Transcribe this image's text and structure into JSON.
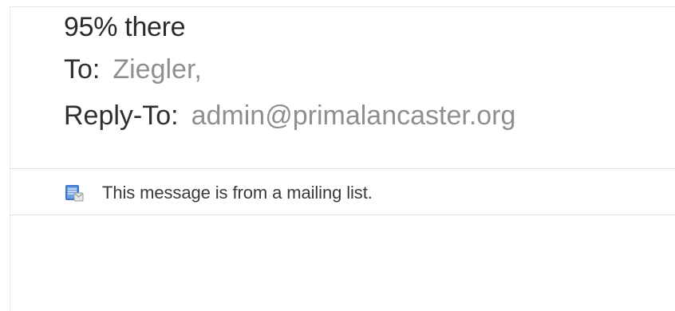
{
  "header": {
    "subject": "95% there",
    "to_label": "To:",
    "to_value": "Ziegler,",
    "reply_to_label": "Reply-To:",
    "reply_to_value": "admin@primalancaster.org"
  },
  "banner": {
    "icon": "mailing-list-icon",
    "text": "This message is from a mailing list."
  },
  "colors": {
    "label": "#2f2f2f",
    "value": "#8f8f8f",
    "divider": "#e2e2e2",
    "icon_blue": "#3f78c8"
  }
}
